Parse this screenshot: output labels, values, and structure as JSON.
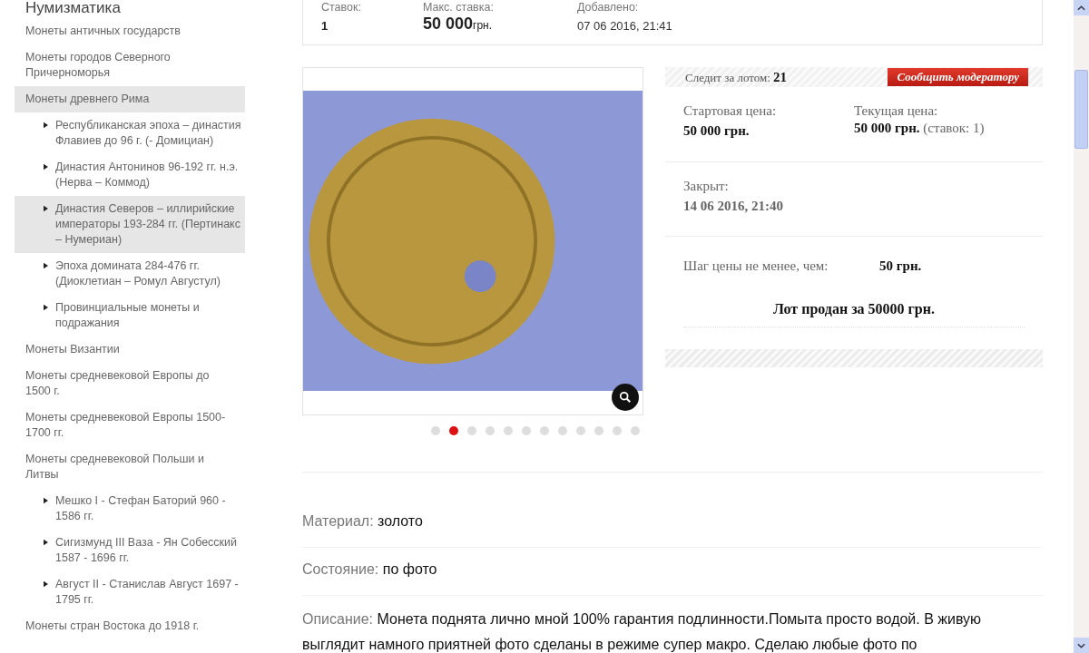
{
  "sidebar": {
    "title": "Нумизматика",
    "items": [
      {
        "label": "Монеты античных государств",
        "selected": false
      },
      {
        "label": "Монеты городов Северного Причерноморья",
        "selected": false
      },
      {
        "label": "Монеты древнего Рима",
        "selected": true,
        "children": [
          {
            "label": "Республиканская эпоха – династия Флавиев до 96 г. (- Домициан)",
            "selected": false
          },
          {
            "label": "Династия Антонинов 96-192 гг. н.э. (Нерва – Коммод)",
            "selected": false
          },
          {
            "label": "Династия Северов – иллирийские императоры 193-284 гг. (Пертинакс – Нумериан)",
            "selected": true
          },
          {
            "label": "Эпоха домината 284-476 гг. (Диоклетиан – Ромул Августул)",
            "selected": false
          },
          {
            "label": "Провинциальные монеты и подражания",
            "selected": false
          }
        ]
      },
      {
        "label": "Монеты Византии",
        "selected": false
      },
      {
        "label": "Монеты средневековой Европы до 1500 г.",
        "selected": false
      },
      {
        "label": "Монеты средневековой Европы 1500-1700 гг.",
        "selected": false
      },
      {
        "label": "Монеты средневековой Польши и Литвы",
        "selected": false,
        "children": [
          {
            "label": "Мешко I - Стефан Баторий 960 - 1586 гг.",
            "selected": false
          },
          {
            "label": "Сигизмунд III Ваза - Ян Собесский 1587 - 1696 гг.",
            "selected": false
          },
          {
            "label": "Август II - Станислав Август 1697 - 1795 гг.",
            "selected": false
          }
        ]
      },
      {
        "label": "Монеты стран Востока до 1918 г.",
        "selected": false
      }
    ]
  },
  "stats": [
    {
      "label": "Ставок:",
      "value": "1"
    },
    {
      "label": "Макс. ставка:",
      "value": "50 000",
      "unit": "грн."
    },
    {
      "label": "Добавлено:",
      "value": "07 06 2016, 21:41"
    }
  ],
  "gallery": {
    "dots": [
      {
        "selected": false
      },
      {
        "selected": true
      },
      {
        "selected": false
      },
      {
        "selected": false
      },
      {
        "selected": false
      },
      {
        "selected": false
      },
      {
        "selected": false
      },
      {
        "selected": false
      },
      {
        "selected": false
      },
      {
        "selected": false
      },
      {
        "selected": false
      },
      {
        "selected": false
      }
    ]
  },
  "lot": {
    "watch_label": "Следит за лотом:",
    "watch_count": "21",
    "report_button": "Сообщить модератору",
    "start_label": "Стартовая цена:",
    "start_value": "50 000 грн.",
    "current_label": "Текущая цена:",
    "current_value": "50 000 грн.",
    "current_note": "(ставок: 1)",
    "closed_label": "Закрыт:",
    "closed_value": "14 06 2016, 21:40",
    "step_label": "Шаг цены не менее, чем:",
    "step_value": "50 грн.",
    "sold_text": "Лот продан за 50000 грн."
  },
  "details": [
    {
      "label": "Материал:",
      "value": "золото"
    },
    {
      "label": "Состояние:",
      "value": "по фото"
    },
    {
      "label": "Описание:",
      "value": "Монета поднята лично мной 100% гарантия подлинности.Помыта просто водой. В живую выглядит намного приятней фото сделаны в режиме супер макро. Сделаю любые фото по"
    }
  ]
}
